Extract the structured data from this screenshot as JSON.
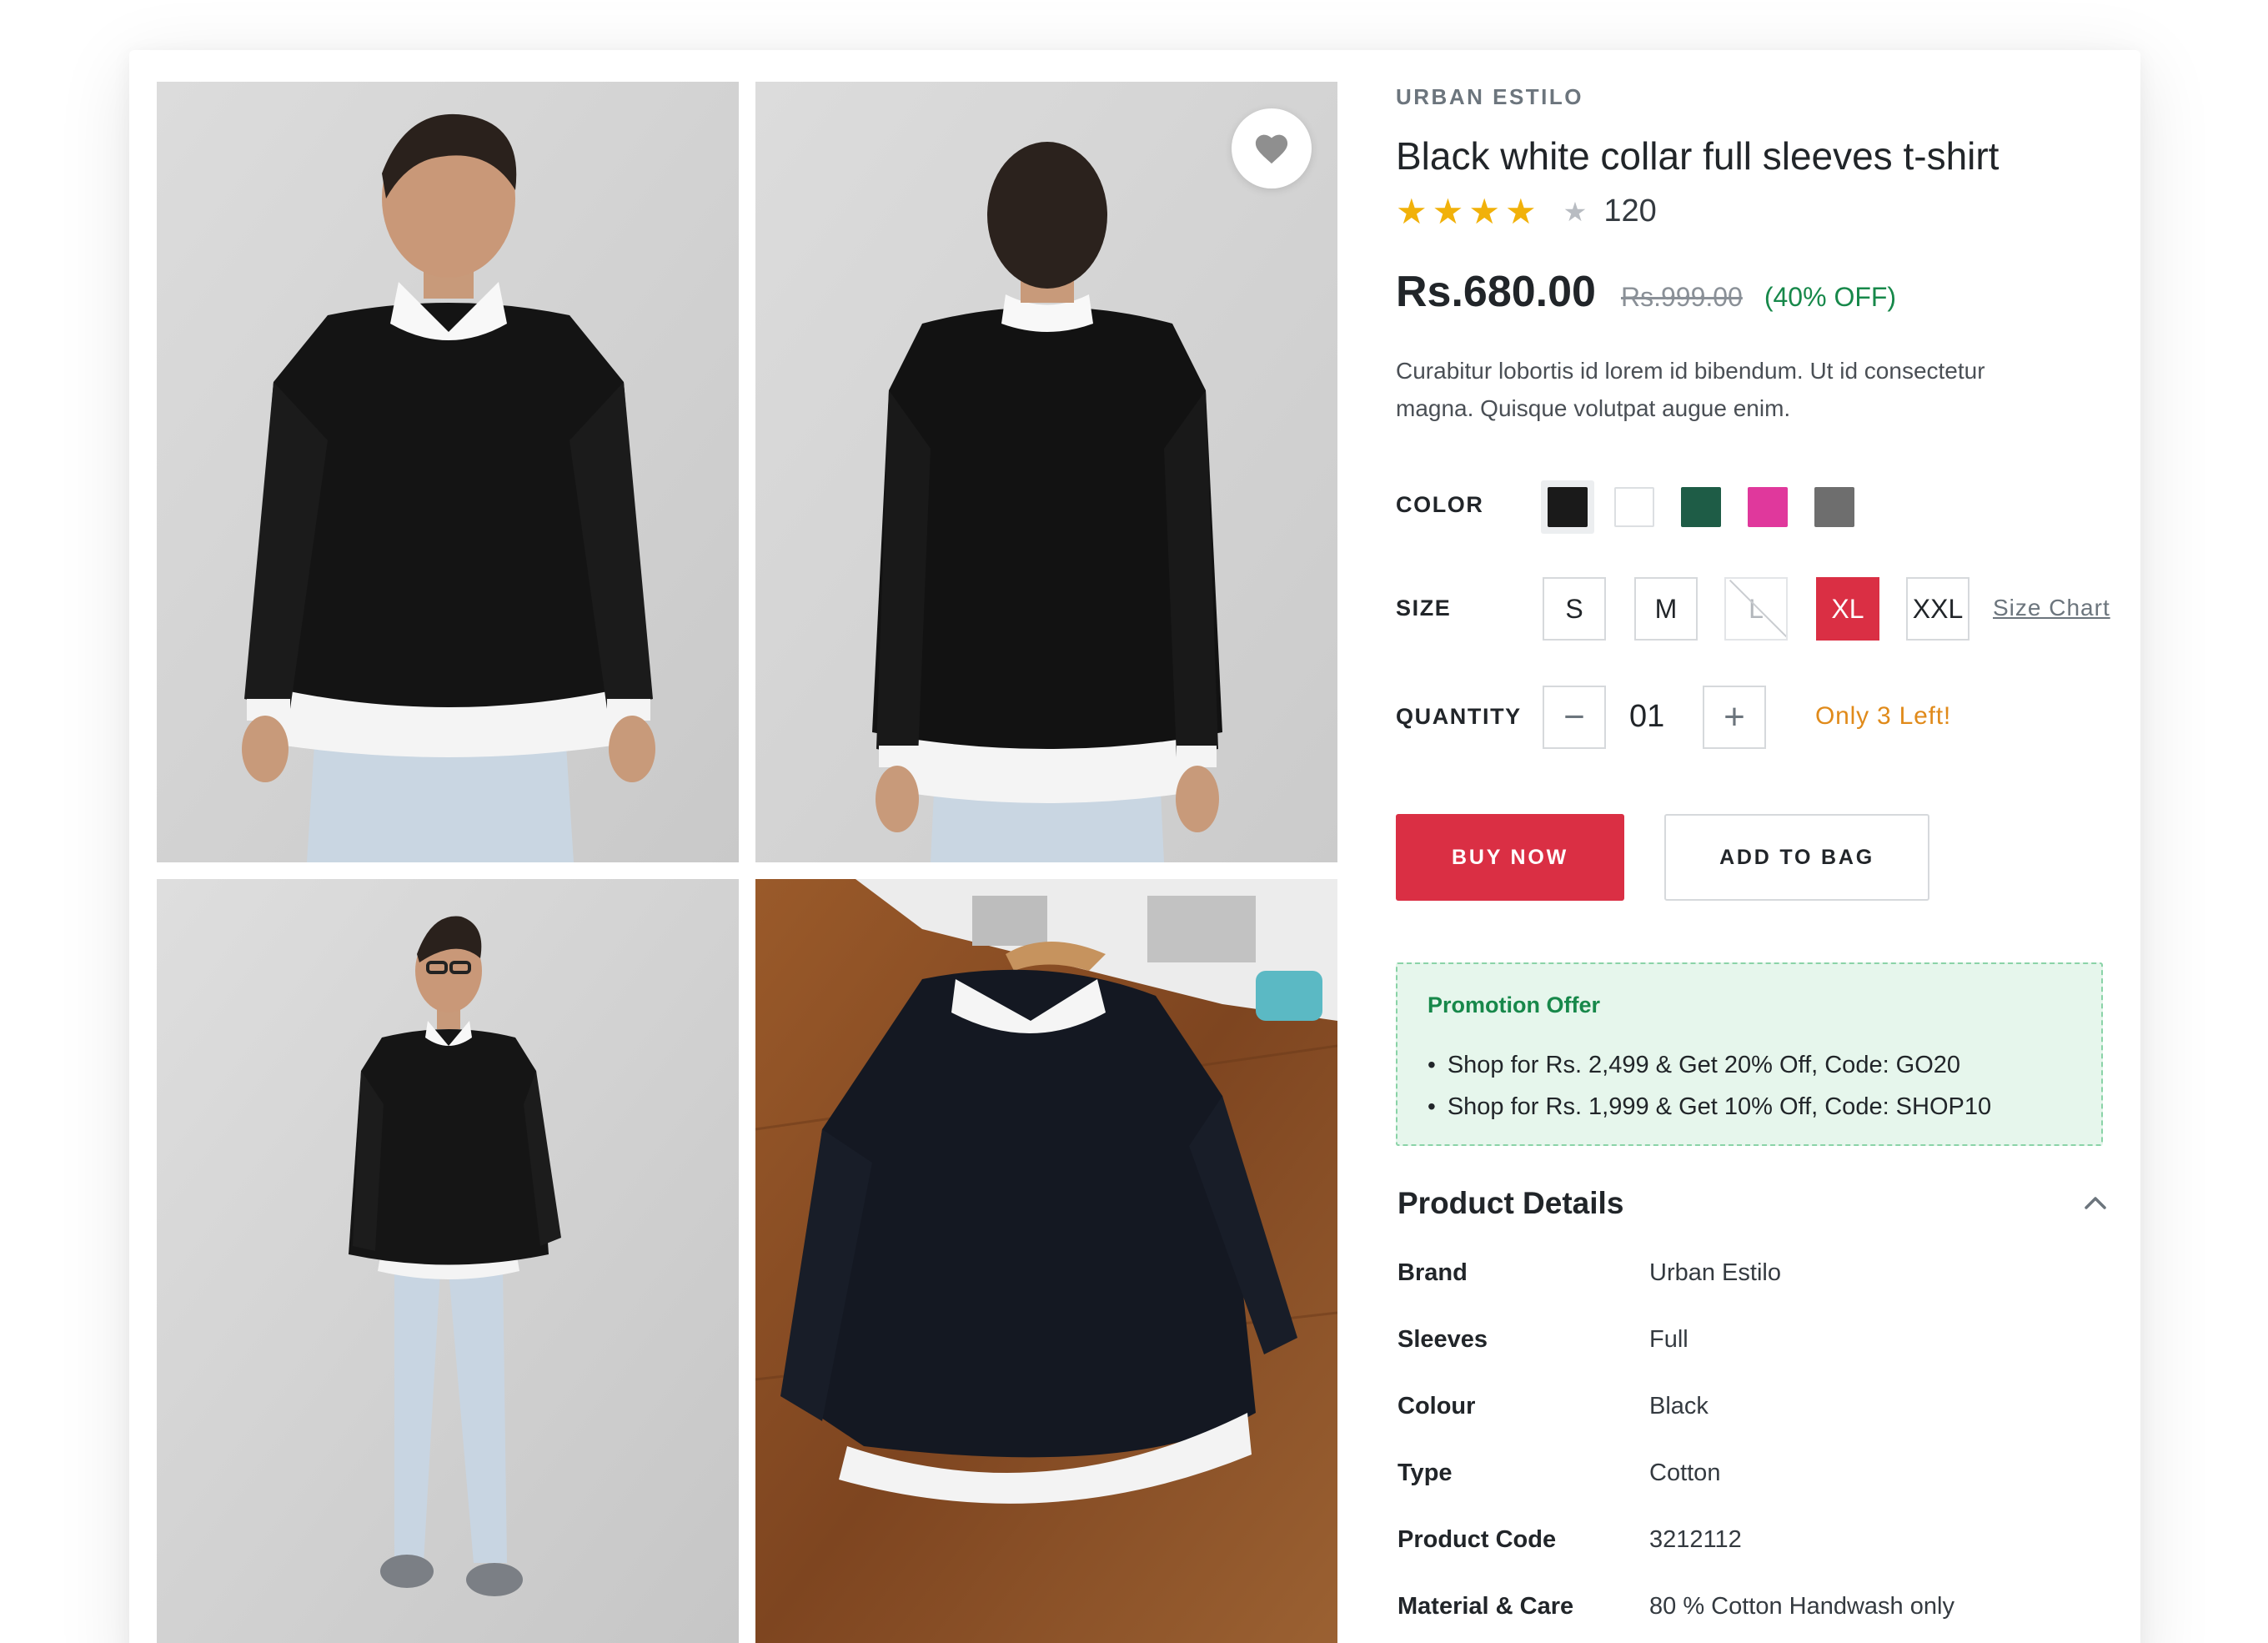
{
  "product": {
    "brand": "URBAN ESTILO",
    "title": "Black white collar full sleeves t-shirt",
    "rating_stars": 4,
    "rating_max": 5,
    "review_count": "120",
    "price": "Rs.680.00",
    "mrp": "Rs.999.00",
    "discount": "(40% OFF)",
    "description": "Curabitur lobortis id lorem id bibendum. Ut id consectetur magna. Quisque volutpat augue enim."
  },
  "color": {
    "label": "COLOR",
    "swatches": [
      {
        "name": "black",
        "hex": "#1a1a1a",
        "selected": true
      },
      {
        "name": "white",
        "hex": "#ffffff",
        "selected": false
      },
      {
        "name": "green",
        "hex": "#1e5c46",
        "selected": false
      },
      {
        "name": "pink",
        "hex": "#e0389c",
        "selected": false
      },
      {
        "name": "grey",
        "hex": "#6e6e6e",
        "selected": false
      }
    ]
  },
  "size": {
    "label": "SIZE",
    "options": [
      {
        "label": "S",
        "state": "normal"
      },
      {
        "label": "M",
        "state": "normal"
      },
      {
        "label": "L",
        "state": "disabled"
      },
      {
        "label": "XL",
        "state": "selected"
      },
      {
        "label": "XXL",
        "state": "normal"
      }
    ],
    "chart_link": "Size Chart"
  },
  "quantity": {
    "label": "QUANTITY",
    "minus": "−",
    "value": "01",
    "plus": "+",
    "stock_note": "Only 3 Left!"
  },
  "actions": {
    "buy_now": "BUY NOW",
    "add_to_bag": "ADD TO BAG"
  },
  "promotion": {
    "title": "Promotion Offer",
    "offers": [
      "Shop for Rs. 2,499 & Get 20% Off,  Code: GO20",
      "Shop for Rs. 1,999 & Get 10% Off, Code: SHOP10"
    ]
  },
  "details": {
    "title": "Product Details",
    "rows": [
      {
        "key": "Brand",
        "value": "Urban Estilo"
      },
      {
        "key": "Sleeves",
        "value": "Full"
      },
      {
        "key": "Colour",
        "value": "Black"
      },
      {
        "key": "Type",
        "value": "Cotton"
      },
      {
        "key": "Product Code",
        "value": "3212112"
      },
      {
        "key": "Material & Care",
        "value": "80 % Cotton Handwash only"
      }
    ]
  },
  "icons": {
    "wishlist": "heart-icon",
    "star": "star-icon",
    "collapse": "chevron-up-icon"
  },
  "colors": {
    "accent_red": "#da2f44",
    "star_gold": "#f1b10a",
    "offer_green": "#17884a",
    "stock_orange": "#e08a1a",
    "promo_bg": "#e6f6ec"
  }
}
